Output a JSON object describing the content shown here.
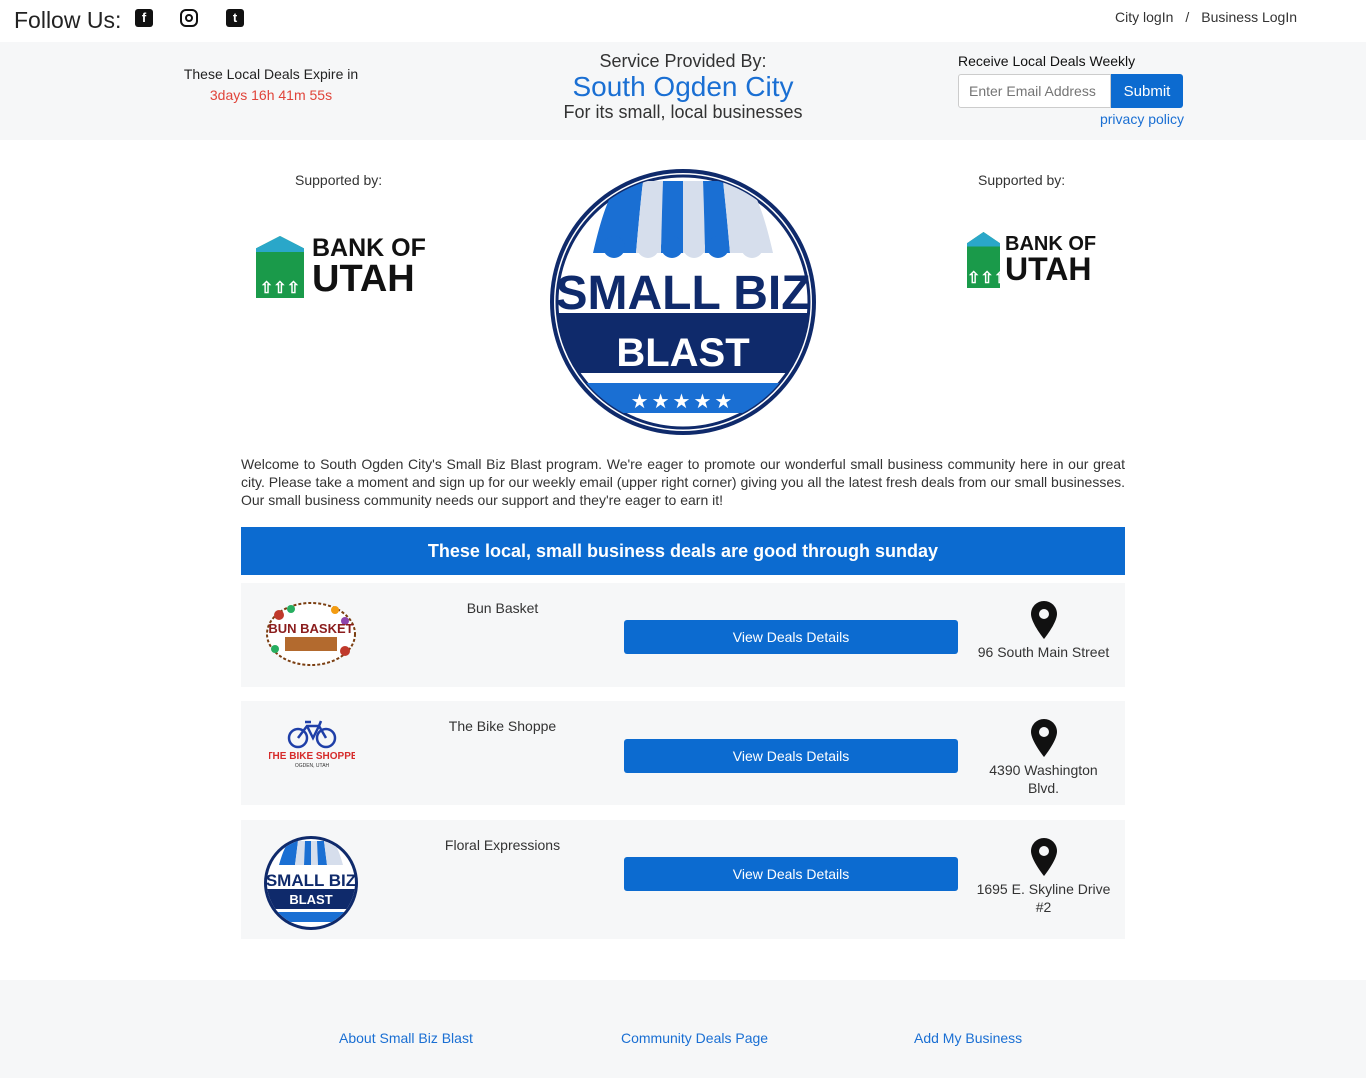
{
  "header": {
    "follow_label": "Follow Us:",
    "social_icons": [
      "facebook-icon",
      "instagram-icon",
      "twitter-icon"
    ],
    "city_login": "City logIn",
    "separator": "/",
    "business_login": "Business LogIn"
  },
  "banner": {
    "expire_label": "These Local Deals Expire in",
    "expire_timer": "3days 16h 41m 55s",
    "service_label": "Service Provided By:",
    "city_name": "South Ogden City",
    "service_sub": "For its small, local businesses",
    "signup_label": "Receive Local Deals Weekly",
    "email_placeholder": "Enter Email Address",
    "submit_label": "Submit",
    "privacy_label": "privacy policy"
  },
  "sponsors": {
    "left_label": "Supported by:",
    "right_label": "Supported by:",
    "bank_line1": "BANK OF",
    "bank_line2": "UTAH"
  },
  "badge": {
    "line1": "SMALL BIZ",
    "line2": "BLAST",
    "stars": "★★★★★"
  },
  "welcome_text": "Welcome to South Ogden City's Small Biz Blast program. We're eager to promote our wonderful small business community here in our great city. Please take a moment and sign up for our weekly email (upper right corner) giving you all the latest fresh deals from our small businesses. Our small business community needs our support and they're eager to earn it!",
  "deals_heading": "These local, small business deals are good through sunday",
  "deals": [
    {
      "name": "Bun Basket",
      "button": "View Deals Details",
      "address": "96 South Main Street",
      "logo_text": "BUN BASKET"
    },
    {
      "name": "The Bike Shoppe",
      "button": "View Deals Details",
      "address": "4390 Washington Blvd.",
      "logo_text": "THE BIKE SHOPPE",
      "logo_sub": "OGDEN, UTAH"
    },
    {
      "name": "Floral Expressions",
      "button": "View Deals Details",
      "address": "1695 E. Skyline Drive #2",
      "logo_text": "SMALL BIZ",
      "logo_sub": "BLAST"
    }
  ],
  "footer": {
    "about": "About Small Biz Blast",
    "community": "Community Deals Page",
    "add": "Add My Business"
  },
  "colors": {
    "accent": "#0c6bd0",
    "timer": "#e0443a",
    "badge_navy": "#0f2a6b",
    "bank_green": "#1a9a4a"
  }
}
